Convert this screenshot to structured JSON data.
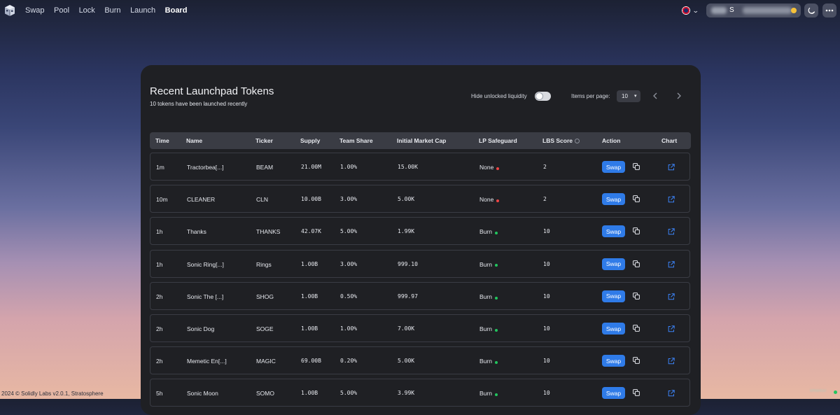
{
  "nav": {
    "items": [
      "Swap",
      "Pool",
      "Lock",
      "Burn",
      "Launch",
      "Board"
    ],
    "active": "Board",
    "account_initial": "S"
  },
  "board": {
    "title": "Recent Launchpad Tokens",
    "subtitle": "10 tokens have been launched recently",
    "hide_unlocked_label": "Hide unlocked liquidity",
    "hide_unlocked_on": false,
    "items_per_page_label": "Items per page:",
    "items_per_page_value": "10",
    "prev_icon": "chevron-left-icon",
    "next_icon": "chevron-right-icon"
  },
  "table": {
    "columns": [
      "Time",
      "Name",
      "Ticker",
      "Supply",
      "Team Share",
      "Initial Market Cap",
      "LP Safeguard",
      "LBS Score",
      "Action",
      "Chart"
    ],
    "action_label": "Swap",
    "rows": [
      {
        "time": "1m",
        "name": "Tractorbea[...]",
        "ticker": "BEAM",
        "supply": "21.00M",
        "team": "1.00%",
        "mcap": "15.00K",
        "lp": "None",
        "lp_status": "red",
        "score": "2"
      },
      {
        "time": "10m",
        "name": "CLEANER",
        "ticker": "CLN",
        "supply": "10.00B",
        "team": "3.00%",
        "mcap": "5.00K",
        "lp": "None",
        "lp_status": "red",
        "score": "2"
      },
      {
        "time": "1h",
        "name": "Thanks",
        "ticker": "THANKS",
        "supply": "42.07K",
        "team": "5.00%",
        "mcap": "1.99K",
        "lp": "Burn",
        "lp_status": "green",
        "score": "10"
      },
      {
        "time": "1h",
        "name": "Sonic Ring[...]",
        "ticker": "Rings",
        "supply": "1.00B",
        "team": "3.00%",
        "mcap": "999.10",
        "lp": "Burn",
        "lp_status": "green",
        "score": "10"
      },
      {
        "time": "2h",
        "name": "Sonic The [...]",
        "ticker": "SHOG",
        "supply": "1.00B",
        "team": "0.50%",
        "mcap": "999.97",
        "lp": "Burn",
        "lp_status": "green",
        "score": "10"
      },
      {
        "time": "2h",
        "name": "Sonic Dog",
        "ticker": "SOGE",
        "supply": "1.00B",
        "team": "1.00%",
        "mcap": "7.00K",
        "lp": "Burn",
        "lp_status": "green",
        "score": "10"
      },
      {
        "time": "2h",
        "name": "Memetic En[...]",
        "ticker": "MAGIC",
        "supply": "69.00B",
        "team": "0.20%",
        "mcap": "5.00K",
        "lp": "Burn",
        "lp_status": "green",
        "score": "10"
      },
      {
        "time": "5h",
        "name": "Sonic Moon",
        "ticker": "SOMO",
        "supply": "1.00B",
        "team": "5.00%",
        "mcap": "3.99K",
        "lp": "Burn",
        "lp_status": "green",
        "score": "10"
      }
    ]
  },
  "colors": {
    "accent": "#2f7be8",
    "status_green": "#22c55e",
    "status_red": "#ef4444",
    "card_bg": "#1f2024"
  },
  "footer": {
    "text": "2024 © Solidly Labs v2.0.1, Stratosphere"
  }
}
